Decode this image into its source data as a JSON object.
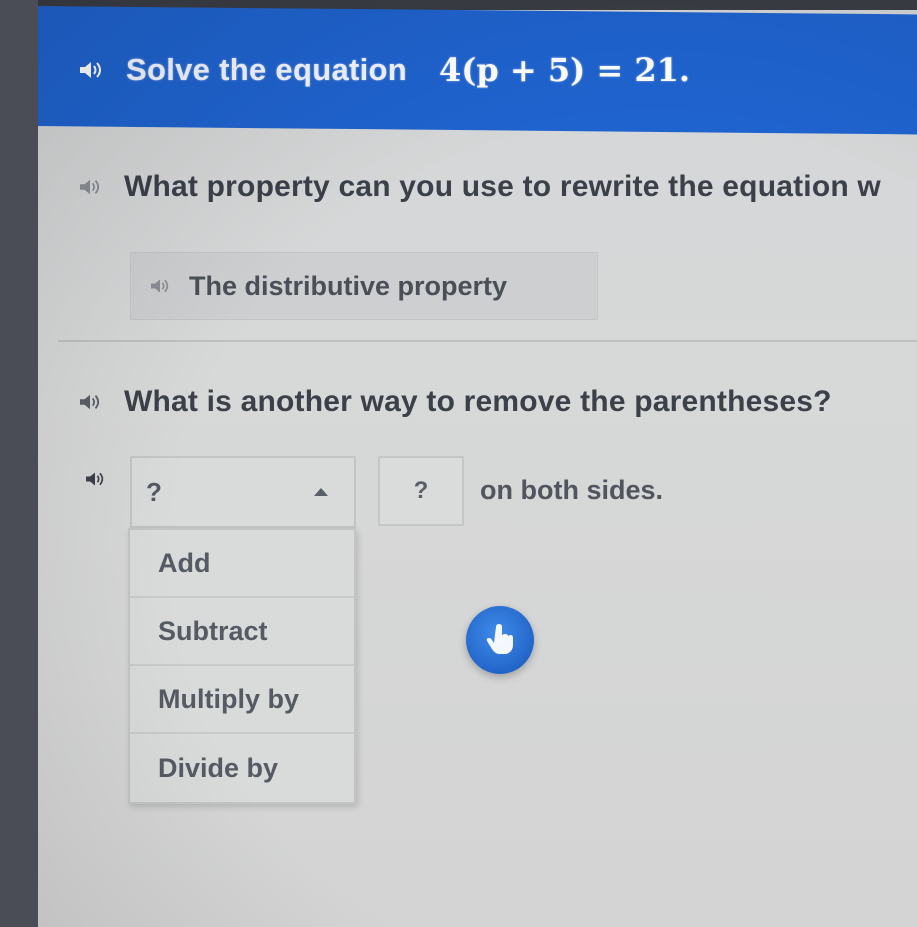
{
  "header": {
    "prompt": "Solve the equation",
    "equation": "4(p + 5) = 21."
  },
  "question1": {
    "text": "What property can you use to rewrite the equation w"
  },
  "answer1": {
    "text": "The distributive property"
  },
  "question2": {
    "text": "What is another way to remove the parentheses?"
  },
  "row3": {
    "select_value": "?",
    "number_value": "?",
    "suffix": "on both sides."
  },
  "dropdown": {
    "options": [
      "Add",
      "Subtract",
      "Multiply by",
      "Divide by"
    ]
  },
  "colors": {
    "header_blue": "#1f63cf",
    "hint_blue": "#2a6fd6"
  },
  "icons": {
    "speaker": "speaker-icon",
    "hint": "hand-pointer-icon"
  }
}
